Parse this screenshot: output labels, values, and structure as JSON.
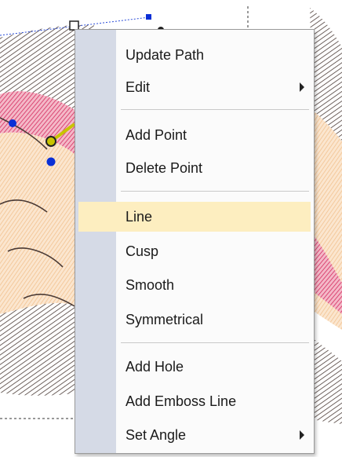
{
  "context_menu": {
    "items": [
      {
        "label": "Update Path"
      },
      {
        "label": "Edit"
      },
      {
        "label": "Add Point"
      },
      {
        "label": "Delete Point"
      },
      {
        "label": "Line"
      },
      {
        "label": "Cusp"
      },
      {
        "label": "Smooth"
      },
      {
        "label": "Symmetrical"
      },
      {
        "label": "Add Hole"
      },
      {
        "label": "Add Emboss Line"
      },
      {
        "label": "Set Angle"
      }
    ],
    "highlighted_item": "Line"
  },
  "colors": {
    "highlight": "#fdeec0",
    "gutter": "#d5dae6",
    "stitch_brown": "#4a3a35",
    "stitch_pink": "#d83a6a",
    "stitch_peach": "#f6cfa2",
    "node_blue": "#0a2fd6",
    "node_yellow": "#c8c400"
  }
}
